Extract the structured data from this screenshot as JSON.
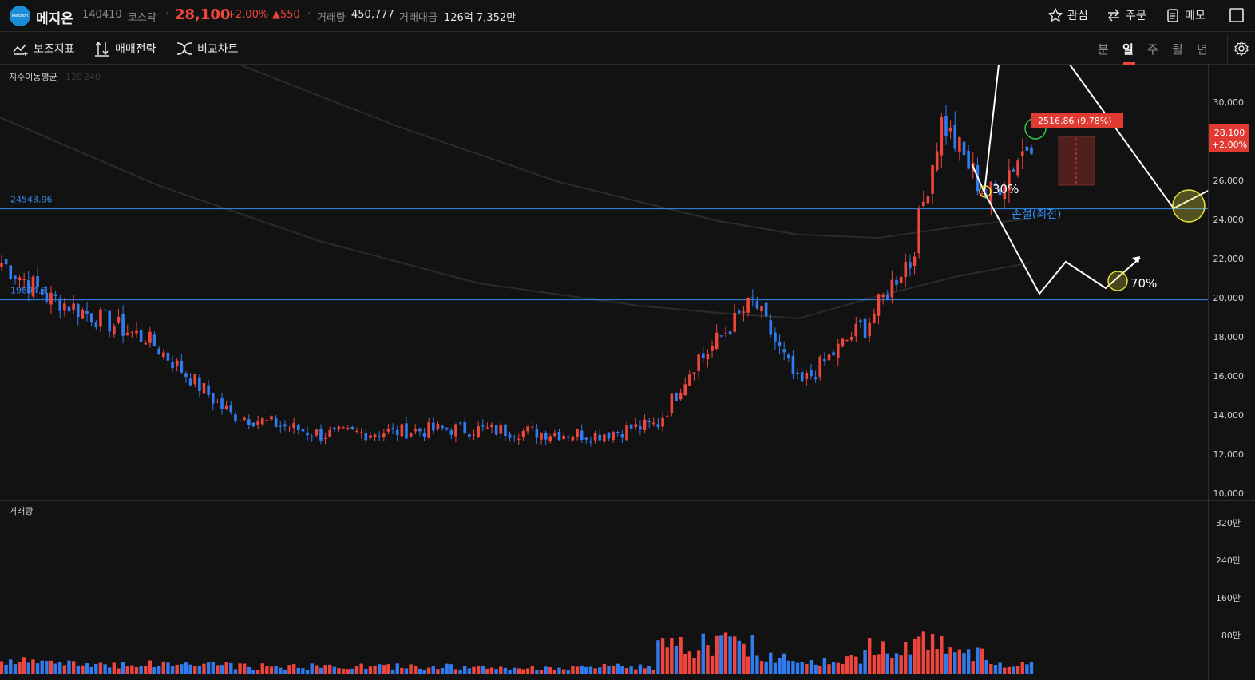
{
  "header": {
    "logo_text": "Mezzion",
    "name": "메지온",
    "code": "140410",
    "market": "코스닥",
    "price": "28,100",
    "change_pct": "+2.00%",
    "change_amt": "▲550",
    "volume_label": "거래량",
    "volume_value": "450,777",
    "amount_label": "거래대금",
    "amount_value": "126억 7,352만",
    "buttons": {
      "watch": "관심",
      "order": "주문",
      "memo": "메모"
    }
  },
  "toolbar": {
    "indicators": "보조지표",
    "strategy": "매매전략",
    "compare": "비교차트",
    "periods": [
      "분",
      "일",
      "주",
      "월",
      "년"
    ],
    "active_period": "일"
  },
  "colors": {
    "up": "#f0453c",
    "down": "#2f7bef",
    "line": "#2f8cf0",
    "background": "#121213",
    "marker_yellow": "#e8e33a",
    "marker_green": "#37c24a"
  },
  "chart_data": {
    "type": "candlestick",
    "ma_label": "지수이동평균",
    "ma_periods": [
      "120",
      "240"
    ],
    "volume_label": "거래량",
    "ylim": [
      10000,
      31000
    ],
    "y_ticks": [
      "30,000",
      "28,000",
      "26,000",
      "24,000",
      "22,000",
      "20,000",
      "18,000",
      "16,000",
      "14,000",
      "12,000",
      "10,000"
    ],
    "volume_ticks": [
      "320만",
      "240만",
      "160만",
      "80만"
    ],
    "current_price": {
      "price": "28,100",
      "change": "+2.00%"
    },
    "horizontal_lines": [
      {
        "label": "24543.96",
        "value": 24543.96
      },
      {
        "label": "19894.3",
        "value": 19894.3
      }
    ],
    "annotations": {
      "measure": "2516.86  (9.78%)",
      "pct_30": "30%",
      "pct_70": "70%",
      "stop_loss": "손절(최전)"
    },
    "segments": [
      {
        "n": 12,
        "start": 21800,
        "end": 19900,
        "vol": 25
      },
      {
        "n": 20,
        "start": 19900,
        "end": 18000,
        "vol": 20
      },
      {
        "n": 20,
        "start": 18000,
        "end": 14000,
        "vol": 20
      },
      {
        "n": 20,
        "start": 14000,
        "end": 13000,
        "vol": 15
      },
      {
        "n": 30,
        "start": 13000,
        "end": 13300,
        "vol": 15
      },
      {
        "n": 30,
        "start": 13300,
        "end": 13000,
        "vol": 12
      },
      {
        "n": 14,
        "start": 13000,
        "end": 13500,
        "vol": 15
      },
      {
        "n": 10,
        "start": 13600,
        "end": 17000,
        "vol": 55
      },
      {
        "n": 12,
        "start": 17000,
        "end": 19800,
        "vol": 65
      },
      {
        "n": 10,
        "start": 19500,
        "end": 15600,
        "vol": 35
      },
      {
        "n": 14,
        "start": 15600,
        "end": 18500,
        "vol": 28
      },
      {
        "n": 10,
        "start": 18500,
        "end": 21800,
        "vol": 60
      },
      {
        "n": 8,
        "start": 21800,
        "end": 29000,
        "vol": 70
      },
      {
        "n": 10,
        "start": 28700,
        "end": 25200,
        "vol": 40
      },
      {
        "n": 10,
        "start": 25300,
        "end": 28100,
        "vol": 20
      }
    ]
  }
}
